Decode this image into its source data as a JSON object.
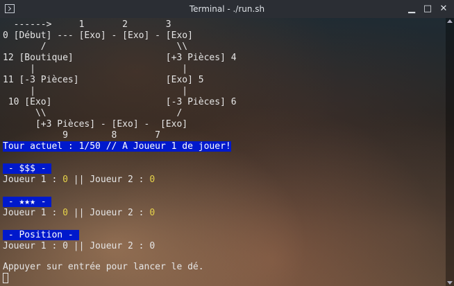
{
  "window": {
    "title": "Terminal - ./run.sh"
  },
  "board": {
    "row1": "  ------>     1       2       3",
    "row2": "0 [Début] --- [Exo] - [Exo] - [Exo]",
    "row3": "       /                        \\\\",
    "row4": "12 [Boutique]                 [+3 Pièces] 4",
    "row5": "     |                           |",
    "row6": "11 [-3 Pièces]                [Exo] 5",
    "row7": "     |                           |",
    "row8": " 10 [Exo]                     [-3 Pièces] 6",
    "row9": "      \\\\                        /",
    "row10": "      [+3 Pièces] - [Exo] -  [Exo]",
    "row11": "           9        8       7"
  },
  "status": {
    "turn_line": "Tour actuel : 1/50 // A Joueur 1 de jouer!"
  },
  "money": {
    "header": " - $$$ - ",
    "p1_label": "Joueur 1 : ",
    "p1_value": "0",
    "sep": " || ",
    "p2_label": "Joueur 2 : ",
    "p2_value": "0"
  },
  "stars": {
    "header": " - ★★★ - ",
    "p1_label": "Joueur 1 : ",
    "p1_value": "0",
    "sep": " || ",
    "p2_label": "Joueur 2 : ",
    "p2_value": "0"
  },
  "position": {
    "header": " - Position - ",
    "text": "Joueur 1 : 0 || Joueur 2 : 0"
  },
  "prompt": {
    "text": "Appuyer sur entrée pour lancer le dé."
  },
  "icons": {
    "app": "terminal-icon",
    "min": "minimize-icon",
    "max": "maximize-icon",
    "close": "close-icon"
  }
}
